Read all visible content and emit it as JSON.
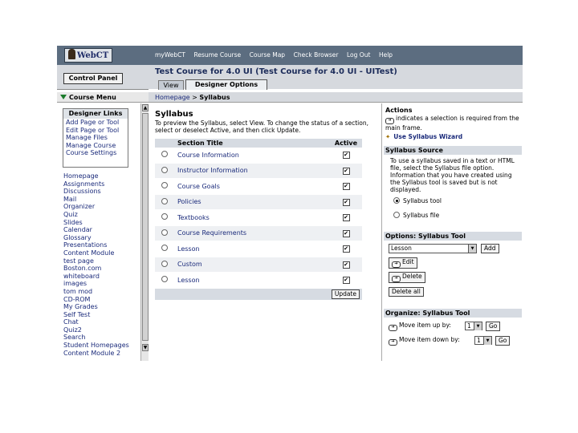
{
  "topbar": {
    "logo_text": "WebCT",
    "nav": [
      "myWebCT",
      "Resume Course",
      "Course Map",
      "Check Browser",
      "Log Out",
      "Help"
    ]
  },
  "left": {
    "control_panel_label": "Control Panel",
    "course_menu_label": "Course Menu",
    "designer_links_title": "Designer Links",
    "designer_links": [
      "Add Page or Tool",
      "Edit Page or Tool",
      "Manage Files",
      "Manage Course",
      "Course Settings"
    ],
    "menu_items": [
      "Homepage",
      "Assignments",
      "Discussions",
      "Mail",
      "Organizer",
      "Quiz",
      "Slides",
      "Calendar",
      "Glossary",
      "Presentations",
      "Content Module",
      "test page",
      "Boston.com",
      "whiteboard",
      "images",
      "tom mod",
      "CD-ROM",
      "My Grades",
      "Self Test",
      "Chat",
      "Quiz2",
      "Search",
      "Student Homepages",
      "Content Module 2"
    ]
  },
  "header": {
    "course_title": "Test Course for 4.0 UI (Test Course for 4.0 UI - UITest)",
    "tab_view": "View",
    "tab_designer": "Designer Options",
    "breadcrumb_home": "Homepage",
    "breadcrumb_sep": ">",
    "breadcrumb_current": "Syllabus"
  },
  "main": {
    "page_title": "Syllabus",
    "intro": "To preview the Syllabus, select View. To change the status of a section, select or deselect Active, and then click Update.",
    "col_section_title": "Section Title",
    "col_active": "Active",
    "rows": [
      {
        "title": "Course Information",
        "active": "✔"
      },
      {
        "title": "Instructor Information",
        "active": "✔"
      },
      {
        "title": "Course Goals",
        "active": "✔"
      },
      {
        "title": "Policies",
        "active": "✔"
      },
      {
        "title": "Textbooks",
        "active": "✔"
      },
      {
        "title": "Course Requirements",
        "active": "✔"
      },
      {
        "title": "Lesson",
        "active": "✔"
      },
      {
        "title": "Custom",
        "active": "✔"
      },
      {
        "title": "Lesson",
        "active": "✔"
      }
    ],
    "update_label": "Update"
  },
  "right": {
    "actions_title": "Actions",
    "actions_note": "indicates a selection is required from the main frame.",
    "wizard_label": "Use Syllabus Wizard",
    "source_title": "Syllabus Source",
    "source_text": "To use a syllabus saved in a text or HTML file, select the Syllabus file option. Information that you have created using the Syllabus tool is saved but is not displayed.",
    "opt_tool": "Syllabus tool",
    "opt_file": "Syllabus file",
    "options_title": "Options: Syllabus Tool",
    "select_value": "Lesson",
    "add_label": "Add",
    "edit_label": "Edit",
    "delete_label": "Delete",
    "delete_all_label": "Delete all",
    "organize_title": "Organize: Syllabus Tool",
    "move_up_label": "Move item up by:",
    "move_down_label": "Move item down by:",
    "step_value": "1",
    "go_label": "Go"
  },
  "colors": {
    "topbar": "#5c6d80",
    "header_bg": "#d6d9de",
    "table_header": "#d6dbe2",
    "link": "#1a2a7a"
  }
}
